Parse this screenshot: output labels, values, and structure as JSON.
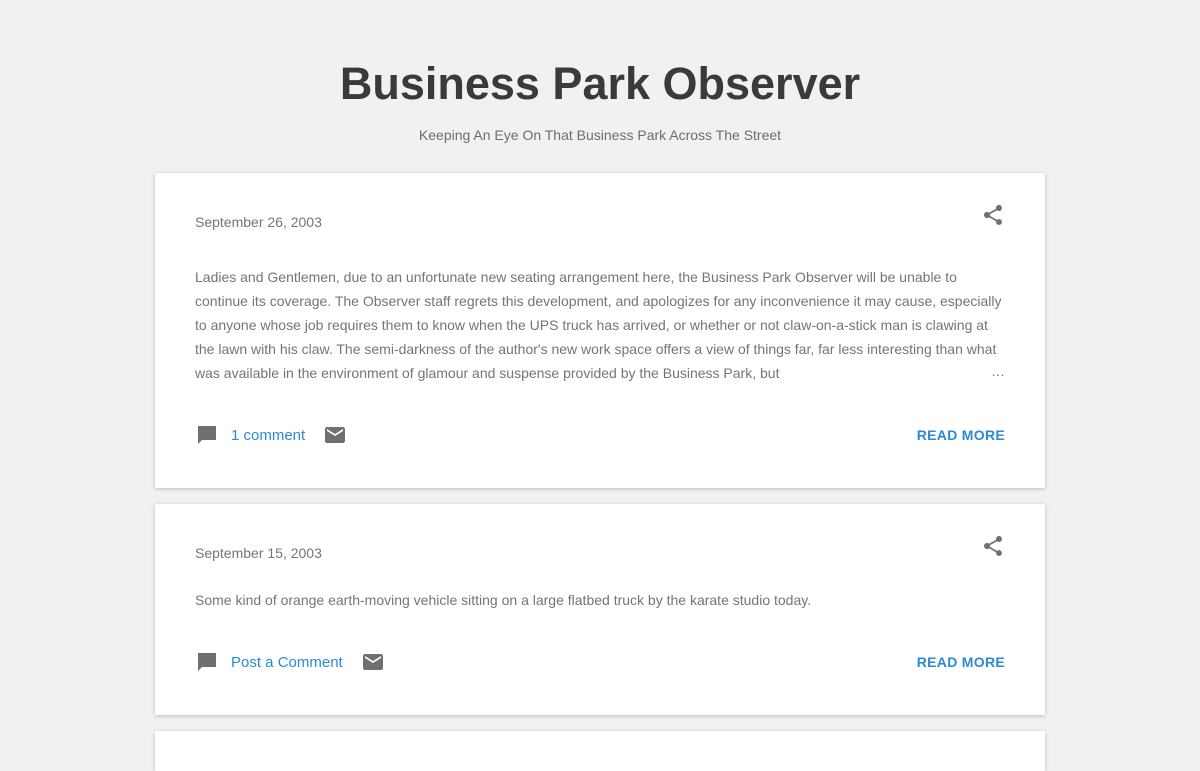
{
  "blog": {
    "title": "Business Park Observer",
    "description": "Keeping An Eye On That Business Park Across The Street"
  },
  "posts": [
    {
      "date": "September 26, 2003",
      "snippet": "Ladies and Gentlemen, due to an unfortunate new seating arrangement here, the Business Park Observer will be unable to continue its coverage. The Observer staff regrets this development, and apologizes for any inconvenience it may cause, especially to anyone whose job requires them to know when the UPS truck has arrived, or whether or not claw-on-a-stick man is clawing at the lawn with his claw. The semi-darkness of the author's new work space offers a view of things far, far less interesting than what was available in the environment of glamour and suspense provided by the Business Park, but",
      "ellipsis": "…",
      "comment_label": "1 comment",
      "read_more": "READ MORE"
    },
    {
      "date": "September 15, 2003",
      "snippet": "Some kind of orange earth-moving vehicle sitting on a large flatbed truck by the karate studio today.",
      "comment_label": "Post a Comment",
      "read_more": "READ MORE"
    }
  ],
  "icons": {
    "share": "share-icon",
    "comment": "comment-icon",
    "email": "email-icon"
  },
  "colors": {
    "background": "#f1f1f1",
    "card": "#ffffff",
    "title": "#3a3a3a",
    "text": "#757575",
    "link": "#2b8ad6",
    "icon": "#707070"
  }
}
